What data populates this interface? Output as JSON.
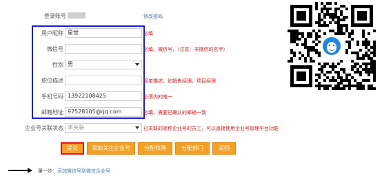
{
  "form": {
    "login_account": {
      "label": "登录账号",
      "action": "修改密码"
    },
    "nickname": {
      "label": "用户昵称",
      "value": "星世",
      "hint": "必填"
    },
    "wechat": {
      "label": "微信号",
      "value": "",
      "hint": "必填，微信号，（注意：非微信的名字）"
    },
    "gender": {
      "label": "性别",
      "value": "男"
    },
    "position": {
      "label": "职位描述",
      "value": "",
      "hint": "简单描述，如销售经理，项目经理"
    },
    "phone": {
      "label": "手机号码",
      "value": "13922108425",
      "hint": "必须内的唯一"
    },
    "email": {
      "label": "邮箱地址",
      "value": "97528105@qq.com",
      "hint": "必填，需要已确认的邮箱一致"
    },
    "enterprise": {
      "label": "企业号关联状态",
      "value": "未关联",
      "hint": "已关联的昵称企业号的员工，可以直接使用企业号管理平台功能"
    }
  },
  "buttons": {
    "submit": "提交",
    "add_enterprise": "添加关注企业号",
    "assign_permission": "分配权限",
    "assign_department": "分配部门",
    "back": "返回"
  },
  "footer": {
    "step": "第一步：",
    "step_text": "添加微信号到微信企业号"
  },
  "colors": {
    "button": "#f5a025",
    "highlight_border": "#1a1adb",
    "hint_text": "#e01a1a",
    "submit_outline": "#e0151a"
  },
  "icons": [
    "qr-code",
    "qq-penguin-icon",
    "chevron-down-icon",
    "arrow-right-icon"
  ]
}
